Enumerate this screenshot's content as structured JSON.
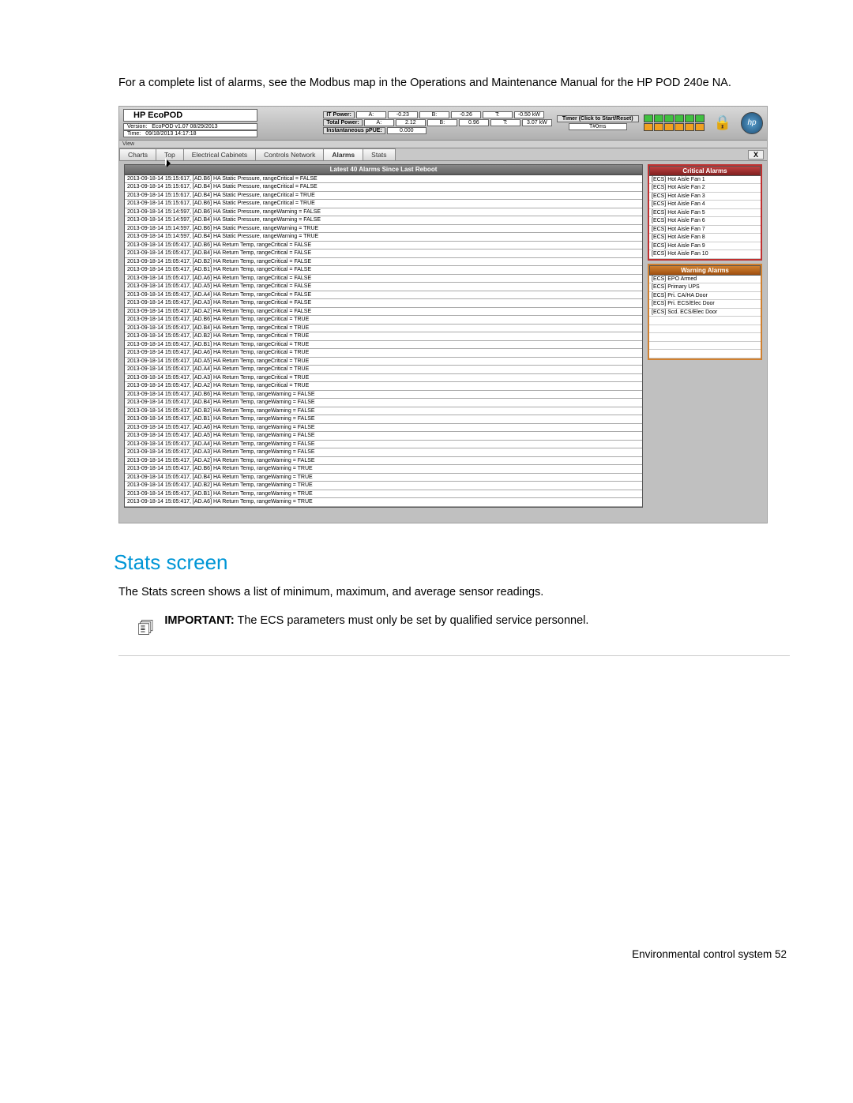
{
  "intro": "For a complete list of alarms, see the Modbus map in the Operations and Maintenance Manual for the HP POD 240e NA.",
  "app": {
    "brand": "HP EcoPOD",
    "version_label": "Version:",
    "version_value": "EcoPOD v1.07 08/29/2013",
    "time_label": "Time:",
    "time_value": "09/18/2013 14:17:18",
    "it_power_label": "IT Power:",
    "total_power_label": "Total Power:",
    "pue_label": "Instantaneous pPUE:",
    "pue_value": "0.000",
    "it_power": {
      "A": "-0.23",
      "B": "-0.26",
      "T": "-0.50 kW"
    },
    "total_power": {
      "A": "2.12",
      "B": "0.96",
      "T": "3.07 kW"
    },
    "timer_label": "Timer (Click to Start/Reset)",
    "timer_value": "T#0ms",
    "view_label": "View"
  },
  "tabs": [
    "Charts",
    "Top",
    "Electrical Cabinets",
    "Controls Network",
    "Alarms",
    "Stats"
  ],
  "close": "X",
  "log_header": "Latest 40 Alarms Since Last Reboot",
  "log_rows": [
    "2013-09-18-14 15:15:617, [AD.B6] HA Static Pressure, rangeCritical = FALSE",
    "2013-09-18-14 15:15:617, [AD.B4] HA Static Pressure, rangeCritical = FALSE",
    "2013-09-18-14 15:15:617, [AD.B4] HA Static Pressure, rangeCritical = TRUE",
    "2013-09-18-14 15:15:617, [AD.B6] HA Static Pressure, rangeCritical = TRUE",
    "2013-09-18-14 15:14:597, [AD.B6] HA Static Pressure, rangeWarning = FALSE",
    "2013-09-18-14 15:14:597, [AD.B4] HA Static Pressure, rangeWarning = FALSE",
    "2013-09-18-14 15:14:597, [AD.B6] HA Static Pressure, rangeWarning = TRUE",
    "2013-09-18-14 15:14:597, [AD.B4] HA Static Pressure, rangeWarning = TRUE",
    "2013-09-18-14 15:05:417, [AD.B6] HA Return Temp, rangeCritical = FALSE",
    "2013-09-18-14 15:05:417, [AD.B4] HA Return Temp, rangeCritical = FALSE",
    "2013-09-18-14 15:05:417, [AD.B2] HA Return Temp, rangeCritical = FALSE",
    "2013-09-18-14 15:05:417, [AD.B1] HA Return Temp, rangeCritical = FALSE",
    "2013-09-18-14 15:05:417, [AD.A6] HA Return Temp, rangeCritical = FALSE",
    "2013-09-18-14 15:05:417, [AD.A5] HA Return Temp, rangeCritical = FALSE",
    "2013-09-18-14 15:05:417, [AD.A4] HA Return Temp, rangeCritical = FALSE",
    "2013-09-18-14 15:05:417, [AD.A3] HA Return Temp, rangeCritical = FALSE",
    "2013-09-18-14 15:05:417, [AD.A2] HA Return Temp, rangeCritical = FALSE",
    "2013-09-18-14 15:05:417, [AD.B6] HA Return Temp, rangeCritical = TRUE",
    "2013-09-18-14 15:05:417, [AD.B4] HA Return Temp, rangeCritical = TRUE",
    "2013-09-18-14 15:05:417, [AD.B2] HA Return Temp, rangeCritical = TRUE",
    "2013-09-18-14 15:05:417, [AD.B1] HA Return Temp, rangeCritical = TRUE",
    "2013-09-18-14 15:05:417, [AD.A6] HA Return Temp, rangeCritical = TRUE",
    "2013-09-18-14 15:05:417, [AD.A5] HA Return Temp, rangeCritical = TRUE",
    "2013-09-18-14 15:05:417, [AD.A4] HA Return Temp, rangeCritical = TRUE",
    "2013-09-18-14 15:05:417, [AD.A3] HA Return Temp, rangeCritical = TRUE",
    "2013-09-18-14 15:05:417, [AD.A2] HA Return Temp, rangeCritical = TRUE",
    "2013-09-18-14 15:05:417, [AD.B6] HA Return Temp, rangeWarning = FALSE",
    "2013-09-18-14 15:05:417, [AD.B4] HA Return Temp, rangeWarning = FALSE",
    "2013-09-18-14 15:05:417, [AD.B2] HA Return Temp, rangeWarning = FALSE",
    "2013-09-18-14 15:05:417, [AD.B1] HA Return Temp, rangeWarning = FALSE",
    "2013-09-18-14 15:05:417, [AD.A6] HA Return Temp, rangeWarning = FALSE",
    "2013-09-18-14 15:05:417, [AD.A5] HA Return Temp, rangeWarning = FALSE",
    "2013-09-18-14 15:05:417, [AD.A4] HA Return Temp, rangeWarning = FALSE",
    "2013-09-18-14 15:05:417, [AD.A3] HA Return Temp, rangeWarning = FALSE",
    "2013-09-18-14 15:05:417, [AD.A2] HA Return Temp, rangeWarning = FALSE",
    "2013-09-18-14 15:05:417, [AD.B6] HA Return Temp, rangeWarning = TRUE",
    "2013-09-18-14 15:05:417, [AD.B4] HA Return Temp, rangeWarning = TRUE",
    "2013-09-18-14 15:05:417, [AD.B2] HA Return Temp, rangeWarning = TRUE",
    "2013-09-18-14 15:05:417, [AD.B1] HA Return Temp, rangeWarning = TRUE",
    "2013-09-18-14 15:05:417, [AD.A6] HA Return Temp, rangeWarning = TRUE"
  ],
  "critical_header": "Critical Alarms",
  "critical_rows": [
    "[ECS] Hot Aisle Fan 1",
    "[ECS] Hot Aisle Fan 2",
    "[ECS] Hot Aisle Fan 3",
    "[ECS] Hot Aisle Fan 4",
    "[ECS] Hot Aisle Fan 5",
    "[ECS] Hot Aisle Fan 6",
    "[ECS] Hot Aisle Fan 7",
    "[ECS] Hot Aisle Fan 8",
    "[ECS] Hot Aisle Fan 9",
    "[ECS] Hot Aisle Fan 10"
  ],
  "warning_header": "Warning Alarms",
  "warning_rows": [
    "[ECS] EPO Armed",
    "[ECS] Primary UPS",
    "[ECS] Pri. CA/HA Door",
    "[ECS] Pri. ECS/Elec Door",
    "[ECS] Scd. ECS/Elec Door",
    "",
    "",
    "",
    "",
    ""
  ],
  "section_title": "Stats screen",
  "stats_intro": "The Stats screen shows a list of minimum, maximum, and average sensor readings.",
  "important_label": "IMPORTANT:",
  "important_text": "The ECS parameters must only be set by qualified service personnel.",
  "footer": "Environmental control system   52"
}
